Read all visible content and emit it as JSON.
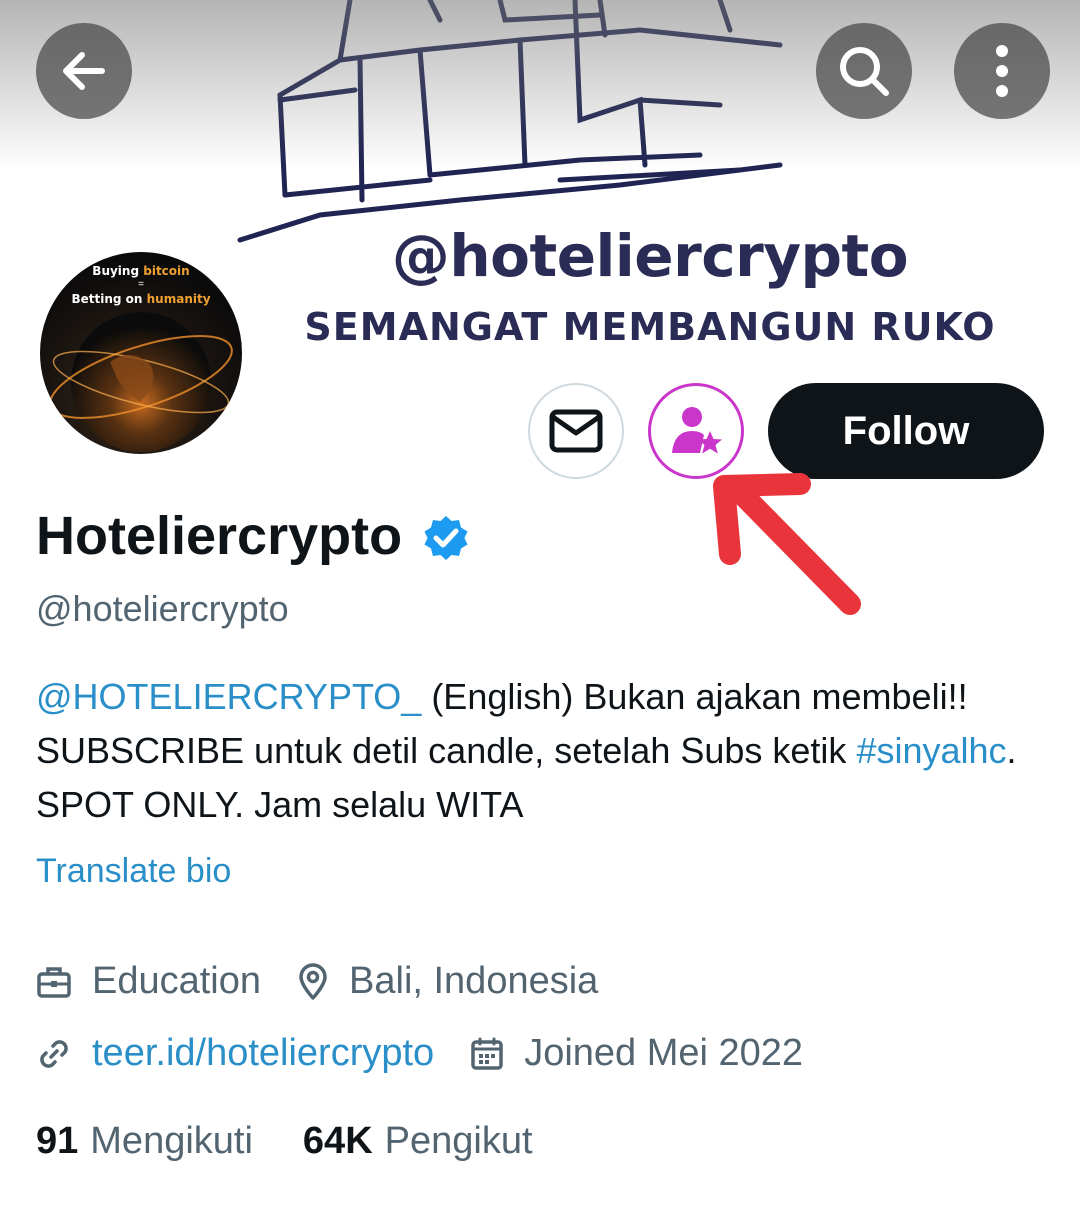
{
  "banner": {
    "handle": "@hoteliercrypto",
    "tagline": "SEMANGAT MEMBANGUN RUKO"
  },
  "topbar": {
    "back_icon": "arrow-left-icon",
    "search_icon": "search-icon",
    "more_icon": "more-vertical-icon"
  },
  "avatar": {
    "line1_a": "Buying ",
    "line1_b": "bitcoin",
    "eq": "=",
    "line2_a": "Betting on ",
    "line2_b": "humanity"
  },
  "actions": {
    "message_icon": "mail-icon",
    "subscribe_icon": "person-star-icon",
    "follow_label": "Follow"
  },
  "profile": {
    "display_name": "Hoteliercrypto",
    "username": "@hoteliercrypto",
    "verified_icon": "verified-badge-icon"
  },
  "bio": {
    "mention": "@HOTELIERCRYPTO_",
    "part1": " (English) Bukan ajakan membeli!! SUBSCRIBE untuk detil candle, setelah Subs ketik ",
    "hashtag": "#sinyalhc",
    "part2": ". SPOT ONLY. Jam selalu WITA",
    "translate_label": "Translate bio"
  },
  "meta": {
    "category": "Education",
    "location": "Bali, Indonesia",
    "website": "teer.id/hoteliercrypto",
    "joined": "Joined Mei 2022"
  },
  "stats": {
    "following_count": "91",
    "following_label": "Mengikuti",
    "followers_count": "64K",
    "followers_label": "Pengikut"
  },
  "colors": {
    "link": "#2a8fc9",
    "subscribe_accent": "#c936c9",
    "annotation_arrow": "#e8343a",
    "verified": "#1d9bf0"
  }
}
